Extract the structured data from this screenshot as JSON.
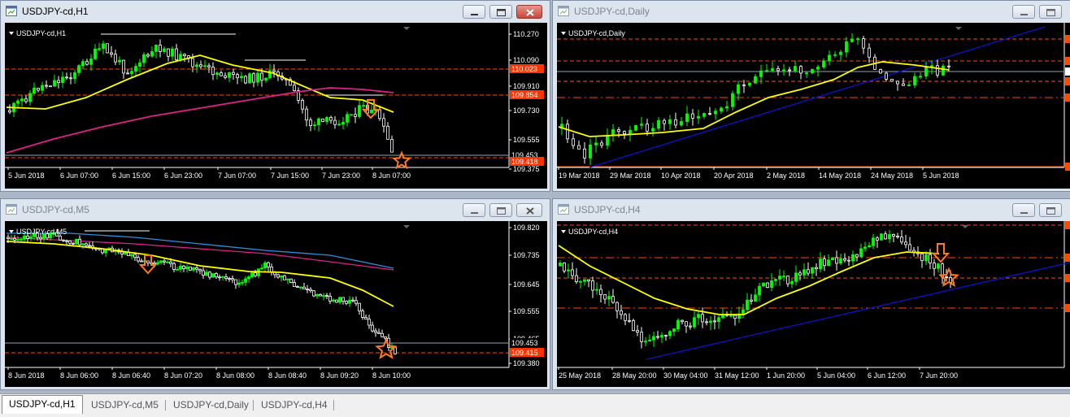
{
  "windows": [
    {
      "id": "h1",
      "title": "USDJPY-cd,H1",
      "label": "USDJPY-cd,H1",
      "active": true,
      "prices": [
        "110.270",
        "110.090",
        "110.023",
        "109.910",
        "109.854",
        "109.730",
        "109.555",
        "109.453",
        "109.418",
        "109.375"
      ],
      "times": [
        "5 Jun 2018",
        "6 Jun 07:00",
        "6 Jun 15:00",
        "6 Jun 23:00",
        "7 Jun 07:00",
        "7 Jun 15:00",
        "7 Jun 23:00",
        "8 Jun 07:00"
      ]
    },
    {
      "id": "daily",
      "title": "USDJPY-cd,Daily",
      "label": "USDJPY-cd,Daily",
      "active": false,
      "prices": [],
      "times": [
        "19 Mar 2018",
        "29 Mar 2018",
        "10 Apr 2018",
        "20 Apr 2018",
        "2 May 2018",
        "14 May 2018",
        "24 May 2018",
        "5 Jun 2018"
      ]
    },
    {
      "id": "m5",
      "title": "USDJPY-cd,M5",
      "label": "USDJPY-cd,M5",
      "active": false,
      "prices": [
        "109.820",
        "109.735",
        "109.645",
        "109.555",
        "109.465",
        "109.453",
        "109.415",
        "109.380"
      ],
      "times": [
        "8 Jun 2018",
        "8 Jun 06:00",
        "8 Jun 06:40",
        "8 Jun 07:20",
        "8 Jun 08:00",
        "8 Jun 08:40",
        "8 Jun 09:20",
        "8 Jun 10:00"
      ]
    },
    {
      "id": "h4",
      "title": "USDJPY-cd,H4",
      "label": "USDJPY-cd,H4",
      "active": false,
      "prices": [],
      "times": [
        "25 May 2018",
        "28 May 20:00",
        "30 May 04:00",
        "31 May 12:00",
        "1 Jun 20:00",
        "5 Jun 04:00",
        "6 Jun 12:00",
        "7 Jun 20:00"
      ]
    }
  ],
  "tabs": [
    "USDJPY-cd,H1",
    "USDJPY-cd,M5",
    "USDJPY-cd,Daily",
    "USDJPY-cd,H4"
  ],
  "colors": {
    "bull": "#00FF00",
    "bear": "#FFFFFF",
    "ma_yellow": "#FFFF00",
    "ma_magenta": "#E0208A",
    "ma_blue": "#2E8FE0",
    "trend": "#1010D0",
    "level": "#FF4A00",
    "annot": "#FF7A20",
    "price_tag_bg": "#FF3300",
    "bid_line": "#8FA0B0"
  }
}
